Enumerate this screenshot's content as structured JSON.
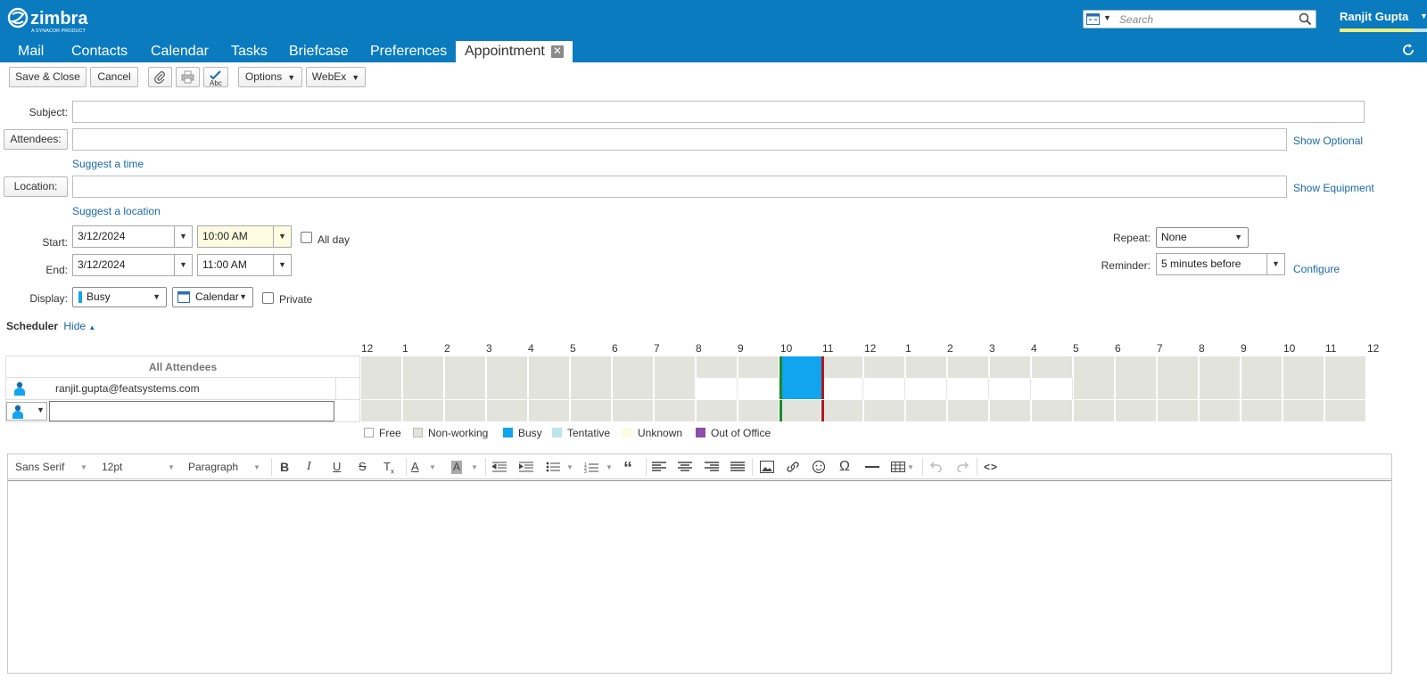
{
  "brand": {
    "name": "zimbra",
    "tagline": "A SYNACOR PRODUCT"
  },
  "search": {
    "placeholder": "Search"
  },
  "user": {
    "name": "Ranjit Gupta"
  },
  "tabs": [
    {
      "label": "Mail"
    },
    {
      "label": "Contacts"
    },
    {
      "label": "Calendar"
    },
    {
      "label": "Tasks"
    },
    {
      "label": "Briefcase"
    },
    {
      "label": "Preferences"
    },
    {
      "label": "Appointment",
      "active": true
    }
  ],
  "toolbar": {
    "save_close": "Save & Close",
    "cancel": "Cancel",
    "options": "Options",
    "webex": "WebEx"
  },
  "form": {
    "subject_label": "Subject:",
    "subject_value": "",
    "attendees_button": "Attendees:",
    "attendees_value": "",
    "show_optional": "Show Optional",
    "suggest_time": "Suggest a time",
    "location_button": "Location:",
    "location_value": "",
    "show_equipment": "Show Equipment",
    "suggest_location": "Suggest a location",
    "start_label": "Start:",
    "start_date": "3/12/2024",
    "start_time": "10:00 AM",
    "all_day": "All day",
    "end_label": "End:",
    "end_date": "3/12/2024",
    "end_time": "11:00 AM",
    "display_label": "Display:",
    "display_value": "Busy",
    "calendar_value": "Calendar",
    "private": "Private",
    "repeat_label": "Repeat:",
    "repeat_value": "None",
    "reminder_label": "Reminder:",
    "reminder_value": "5 minutes before",
    "configure": "Configure"
  },
  "scheduler": {
    "title": "Scheduler",
    "hide": "Hide",
    "hours": [
      "12",
      "1",
      "2",
      "3",
      "4",
      "5",
      "6",
      "7",
      "8",
      "9",
      "10",
      "11",
      "12",
      "1",
      "2",
      "3",
      "4",
      "5",
      "6",
      "7",
      "8",
      "9",
      "10",
      "11",
      "12"
    ],
    "all_attendees": "All Attendees",
    "attendee_email": "ranjit.gupta@featsystems.com",
    "legend": [
      {
        "label": "Free",
        "color": "#ffffff"
      },
      {
        "label": "Non-working",
        "color": "#e3e3dd"
      },
      {
        "label": "Busy",
        "color": "#11a4ef"
      },
      {
        "label": "Tentative",
        "color": "#bde4ea"
      },
      {
        "label": "Unknown",
        "color": "#fdfbe0"
      },
      {
        "label": "Out of Office",
        "color": "#8c4fa5"
      }
    ]
  },
  "editor": {
    "font_family": "Sans Serif",
    "font_size": "12pt",
    "paragraph": "Paragraph"
  },
  "colors": {
    "brand_blue": "#0a7bbf",
    "busy": "#11a4ef",
    "start_marker": "#1a8a2e",
    "end_marker": "#b0191e"
  }
}
